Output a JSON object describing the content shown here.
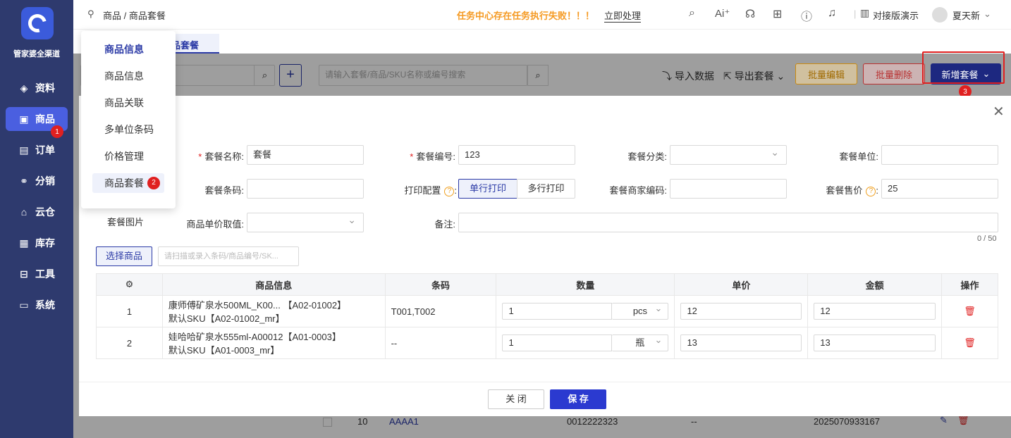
{
  "sidebar": {
    "brand": "管家婆全渠道",
    "items": [
      {
        "label": "资料",
        "icon": "layers-icon"
      },
      {
        "label": "商品",
        "icon": "box-icon"
      },
      {
        "label": "订单",
        "icon": "order-icon"
      },
      {
        "label": "分销",
        "icon": "network-icon"
      },
      {
        "label": "云仓",
        "icon": "cloud-warehouse-icon"
      },
      {
        "label": "库存",
        "icon": "inventory-icon"
      },
      {
        "label": "工具",
        "icon": "toolbox-icon"
      },
      {
        "label": "系统",
        "icon": "monitor-icon"
      }
    ],
    "badge": "1"
  },
  "topbar": {
    "breadcrumb": "商品 / 商品套餐",
    "warning": "任务中心存在任务执行失败！！！",
    "fix_link": "立即处理",
    "org": "对接版演示",
    "user": "夏天新"
  },
  "tabs": {
    "active_suffix": "品套餐"
  },
  "menu": {
    "header": "商品信息",
    "items": [
      "商品信息",
      "商品关联",
      "多单位条码",
      "价格管理",
      "商品套餐"
    ],
    "badge": "2"
  },
  "list": {
    "search_placeholder": "请输入套餐/商品/SKU名称或编号搜索",
    "import": "导入数据",
    "export": "导出套餐",
    "batch_edit": "批量编辑",
    "batch_delete": "批量删除",
    "add": "新增套餐",
    "add_badge": "3",
    "bg_row": {
      "no": "10",
      "name": "AAAA1",
      "code": "0012222323",
      "dash": "--",
      "time": "2025070933167"
    }
  },
  "modal": {
    "fields": {
      "name_label": "套餐名称",
      "name_value": "套餐",
      "code_label": "套餐编号",
      "code_value": "123",
      "category_label": "套餐分类",
      "unit_label": "套餐单位",
      "barcode_label": "套餐条码",
      "print_label": "打印配置",
      "print_single": "单行打印",
      "print_multi": "多行打印",
      "merchant_code_label": "套餐商家编码",
      "price_label": "套餐售价",
      "price_value": "25",
      "image_label": "套餐图片",
      "unit_price_label": "商品单价取值",
      "remark_label": "备注",
      "remark_count": "0 / 50"
    },
    "select_goods": "选择商品",
    "scan_placeholder": "请扫描或录入条码/商品编号/SK...",
    "columns": [
      "商品信息",
      "条码",
      "数量",
      "单价",
      "金额",
      "操作"
    ],
    "rows": [
      {
        "no": "1",
        "info1": "康师傅矿泉水500ML_K00... 【A02-01002】",
        "info2": "默认SKU【A02-01002_mr】",
        "barcode": "T001,T002",
        "qty": "1",
        "unit": "pcs",
        "price": "12",
        "amount": "12"
      },
      {
        "no": "2",
        "info1": "娃哈哈矿泉水555ml-A00012【A01-0003】",
        "info2": "默认SKU【A01-0003_mr】",
        "barcode": "--",
        "qty": "1",
        "unit": "瓶",
        "price": "13",
        "amount": "13"
      }
    ],
    "close": "关 闭",
    "save": "保 存"
  }
}
